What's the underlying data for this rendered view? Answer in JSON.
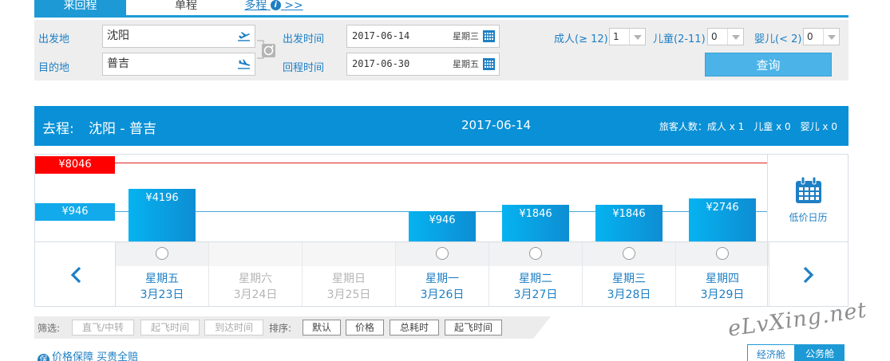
{
  "tabs": {
    "round_trip": "来回程",
    "one_way": "单程",
    "multi": "多程",
    "multi_suffix": ">>"
  },
  "search": {
    "from_label": "出发地",
    "from_value": "沈阳",
    "to_label": "目的地",
    "to_value": "普吉",
    "depart_label": "出发时间",
    "depart_date": "2017-06-14",
    "depart_weekday": "星期三",
    "return_label": "回程时间",
    "return_date": "2017-06-30",
    "return_weekday": "星期五",
    "adult_label": "成人(≥ 12)",
    "adult_value": "1",
    "child_label": "儿童(2-11)",
    "child_value": "0",
    "infant_label": "婴儿(< 2)",
    "infant_value": "0",
    "query_button": "查询"
  },
  "result_header": {
    "route_prefix": "去程:",
    "route": "沈阳 - 普吉",
    "date": "2017-06-14",
    "passengers": "旅客人数：成人 x 1　儿童 x 0　婴儿 x 0"
  },
  "price_chart": {
    "high_price": "¥8046",
    "low_price": "¥946",
    "low_calendar_label": "低价日历"
  },
  "chart_data": {
    "type": "bar",
    "categories": [
      "3月23日",
      "3月24日",
      "3月25日",
      "3月26日",
      "3月27日",
      "3月28日",
      "3月29日"
    ],
    "values": [
      4196,
      null,
      null,
      946,
      1846,
      1846,
      2746
    ],
    "labels": [
      "¥4196",
      "",
      "",
      "¥946",
      "¥1846",
      "¥1846",
      "¥2746"
    ],
    "max": 8046,
    "min": 946,
    "colors": {
      "bar": "#0e9ee0",
      "high_line": "#dd2222",
      "low_line": "#48a9db"
    }
  },
  "days": [
    {
      "weekday": "星期五",
      "date": "3月23日",
      "available": true
    },
    {
      "weekday": "星期六",
      "date": "3月24日",
      "available": false
    },
    {
      "weekday": "星期日",
      "date": "3月25日",
      "available": false
    },
    {
      "weekday": "星期一",
      "date": "3月26日",
      "available": true
    },
    {
      "weekday": "星期二",
      "date": "3月27日",
      "available": true
    },
    {
      "weekday": "星期三",
      "date": "3月28日",
      "available": true
    },
    {
      "weekday": "星期四",
      "date": "3月29日",
      "available": true
    }
  ],
  "filter": {
    "filter_label": "筛选:",
    "direct": "直飞/中转",
    "depart_time": "起飞时间",
    "arrive_time": "到达时间",
    "sort_label": "排序:",
    "sort_default": "默认",
    "sort_price": "价格",
    "sort_duration": "总耗时",
    "sort_depart": "起飞时间"
  },
  "footer": {
    "guarantee_icon": "保",
    "guarantee_text": "价格保障 买贵全赔",
    "watermark": "eLvXing.net",
    "economy": "经济舱",
    "business": "公务舱"
  },
  "icons": {
    "info": "i",
    "prev": "chevron-left-icon",
    "next": "chevron-right-icon",
    "calendar": "calendar-icon",
    "swap": "swap-icon",
    "plane_takeoff": "plane-takeoff-icon",
    "plane_landing": "plane-landing-icon"
  },
  "colors": {
    "primary": "#1d9ad6",
    "header_bg": "#0a90d6",
    "link": "#1d7fc4",
    "high_tag": "#ff0000",
    "low_tag": "#12aaeb"
  }
}
